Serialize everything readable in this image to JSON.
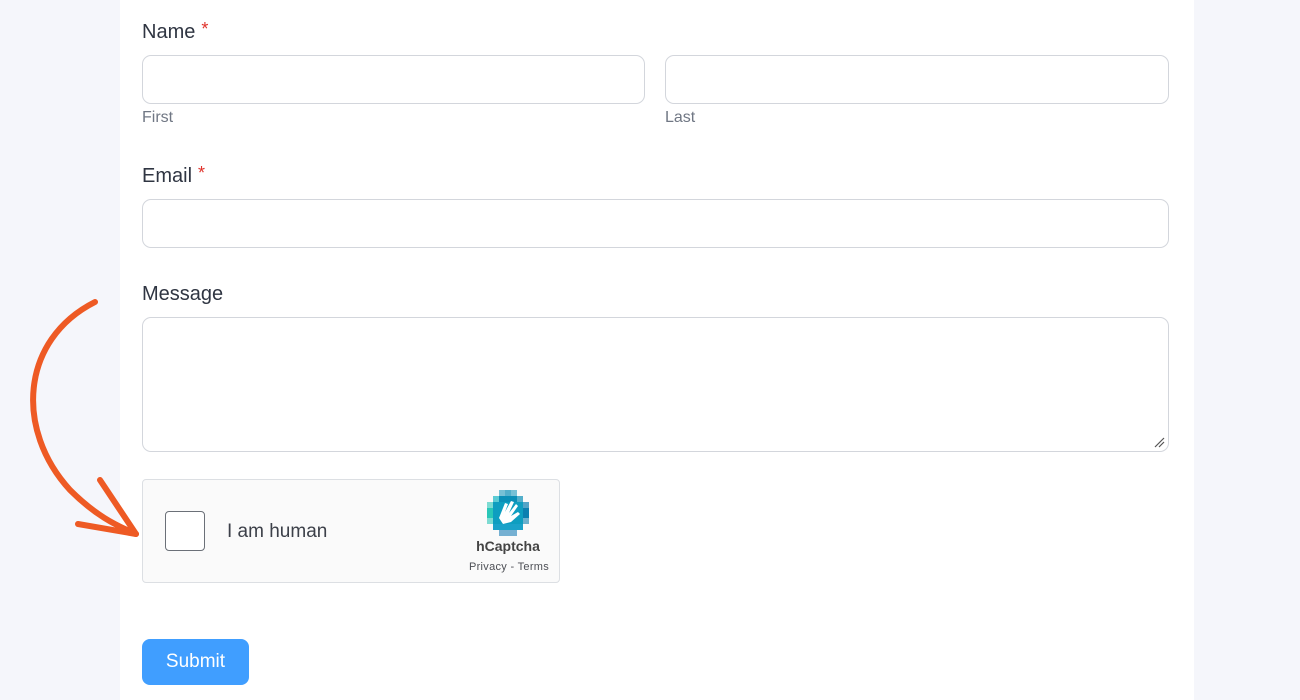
{
  "form": {
    "name": {
      "label": "Name",
      "required_mark": "*",
      "first_sublabel": "First",
      "last_sublabel": "Last",
      "first_value": "",
      "last_value": ""
    },
    "email": {
      "label": "Email",
      "required_mark": "*",
      "value": ""
    },
    "message": {
      "label": "Message",
      "value": ""
    },
    "captcha": {
      "checkbox_label": "I am human",
      "brand": "hCaptcha",
      "privacy_link": "Privacy",
      "separator": "-",
      "terms_link": "Terms"
    },
    "submit_label": "Submit"
  },
  "annotation": {
    "arrow_color": "#ee5a24",
    "arrow_icon": "curved-arrow-icon"
  },
  "colors": {
    "accent": "#409eff",
    "required": "#e0322b",
    "page_bg": "#f5f6fb"
  }
}
